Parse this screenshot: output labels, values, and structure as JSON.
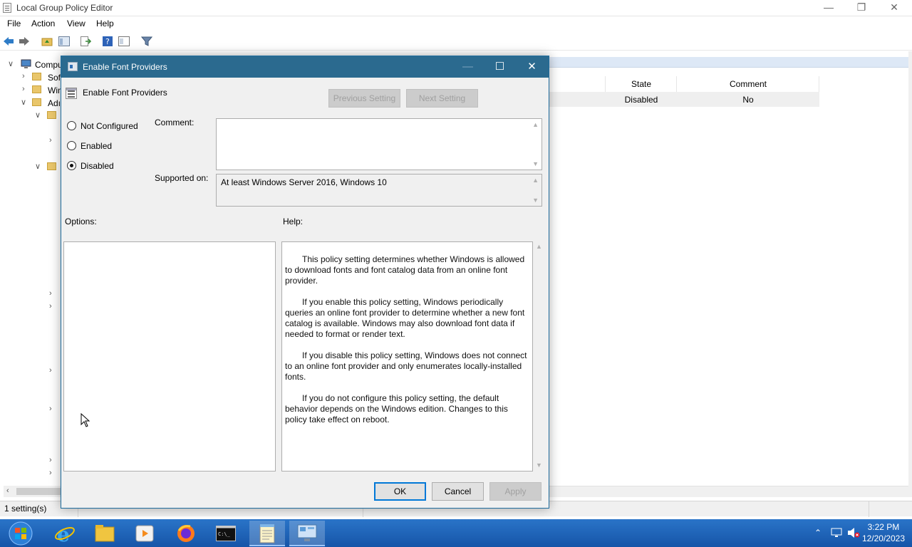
{
  "window": {
    "title": "Local Group Policy Editor",
    "minimize": "—",
    "restore": "❐",
    "close": "✕"
  },
  "menu": {
    "file": "File",
    "action": "Action",
    "view": "View",
    "help": "Help"
  },
  "tree": {
    "items": [
      {
        "label": "Compu"
      },
      {
        "label": "Sof"
      },
      {
        "label": "Win"
      },
      {
        "label": "Adı"
      }
    ]
  },
  "list": {
    "columns": [
      "State",
      "Comment"
    ],
    "rows": [
      {
        "state": "Disabled",
        "comment": "No"
      }
    ]
  },
  "status": {
    "count": "1 setting(s)"
  },
  "dialog": {
    "title": "Enable Font Providers",
    "policy_name": "Enable Font Providers",
    "prev_button": "Previous Setting",
    "next_button": "Next Setting",
    "options": {
      "not_configured": "Not Configured",
      "enabled": "Enabled",
      "disabled": "Disabled",
      "selected": "Disabled"
    },
    "comment_label": "Comment:",
    "comment_value": "",
    "supported_label": "Supported on:",
    "supported_value": "At least Windows Server 2016, Windows 10",
    "options_label": "Options:",
    "help_label": "Help:",
    "help_paragraphs": [
      "This policy setting determines whether Windows is allowed to download fonts and font catalog data from an online font provider.",
      "If you enable this policy setting, Windows periodically queries an online font provider to determine whether a new font catalog is available. Windows may also download font data if needed to format or render text.",
      "If you disable this policy setting, Windows does not connect to an online font provider and only enumerates locally-installed fonts.",
      "If you do not configure this policy setting, the default behavior depends on the Windows edition. Changes to this policy take effect on reboot."
    ],
    "ok": "OK",
    "cancel": "Cancel",
    "apply": "Apply",
    "maximize": "☐",
    "close": "✕"
  },
  "taskbar": {
    "time": "3:22 PM",
    "date": "12/20/2023",
    "apps": [
      "start-orb",
      "internet-explorer",
      "file-explorer",
      "media-player",
      "firefox",
      "command-prompt",
      "notepad",
      "control-panel"
    ]
  }
}
